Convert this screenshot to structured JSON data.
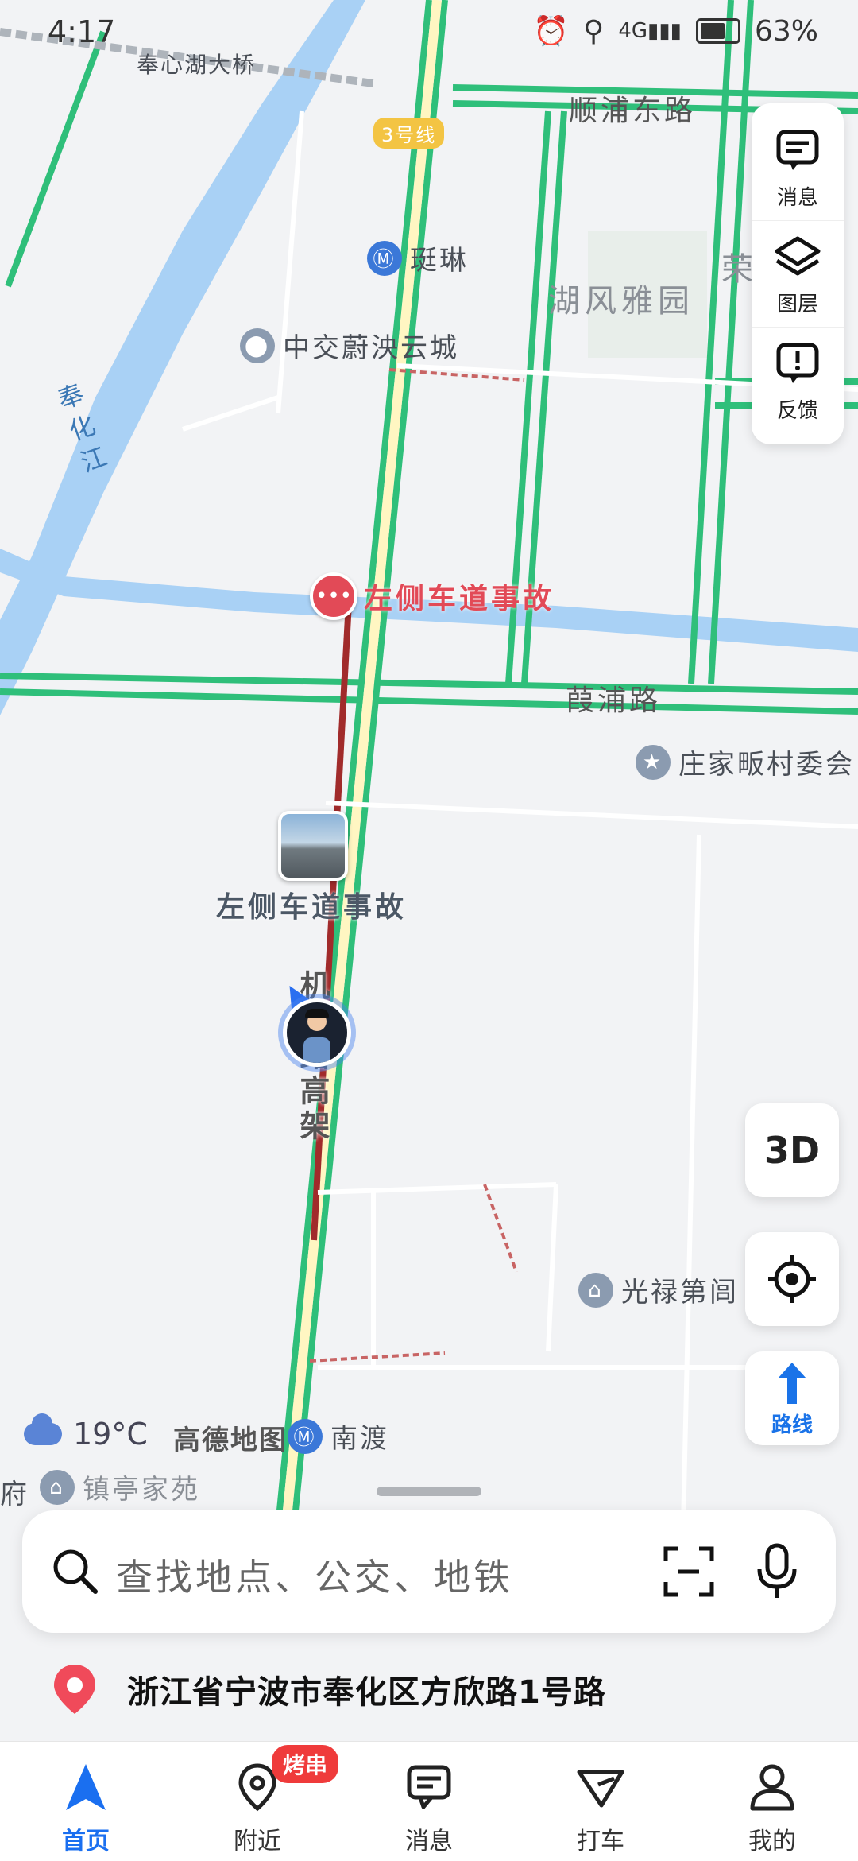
{
  "status_bar": {
    "time": "4:17",
    "battery": "63%"
  },
  "map": {
    "labels": {
      "bridge": "奉心湖大桥",
      "metro_line": "3号线",
      "road_shunpu": "顺浦东路",
      "station": "珽琳",
      "community_hufeng": "湖风雅园",
      "community_rong": "荣",
      "poi_zhongjiao": "中交蔚泱云城",
      "river_fenghua": "奉化江",
      "road_xiapu": "葭浦路",
      "poi_zhuangjia": "庄家畈村委会",
      "poi_guanglu": "光禄第闾",
      "road_vertical": "机南路高架",
      "poi_nandu": "南渡",
      "poi_zhenting": "镇亭家苑",
      "edge_fu": "府"
    },
    "incident_label": "左侧车道事故",
    "photo_marker_label": "左侧车道事故"
  },
  "side_panel": {
    "messages": "消息",
    "layers": "图层",
    "feedback": "反馈"
  },
  "controls": {
    "three_d": "3D",
    "route": "路线"
  },
  "weather": {
    "temp": "19°C",
    "brand": "高德地图"
  },
  "search": {
    "placeholder": "查找地点、公交、地铁"
  },
  "current_location": "浙江省宁波市奉化区方欣路1号路",
  "tabs": [
    {
      "label": "首页",
      "active": true
    },
    {
      "label": "附近",
      "badge": "烤串"
    },
    {
      "label": "消息"
    },
    {
      "label": "打车"
    },
    {
      "label": "我的"
    }
  ]
}
